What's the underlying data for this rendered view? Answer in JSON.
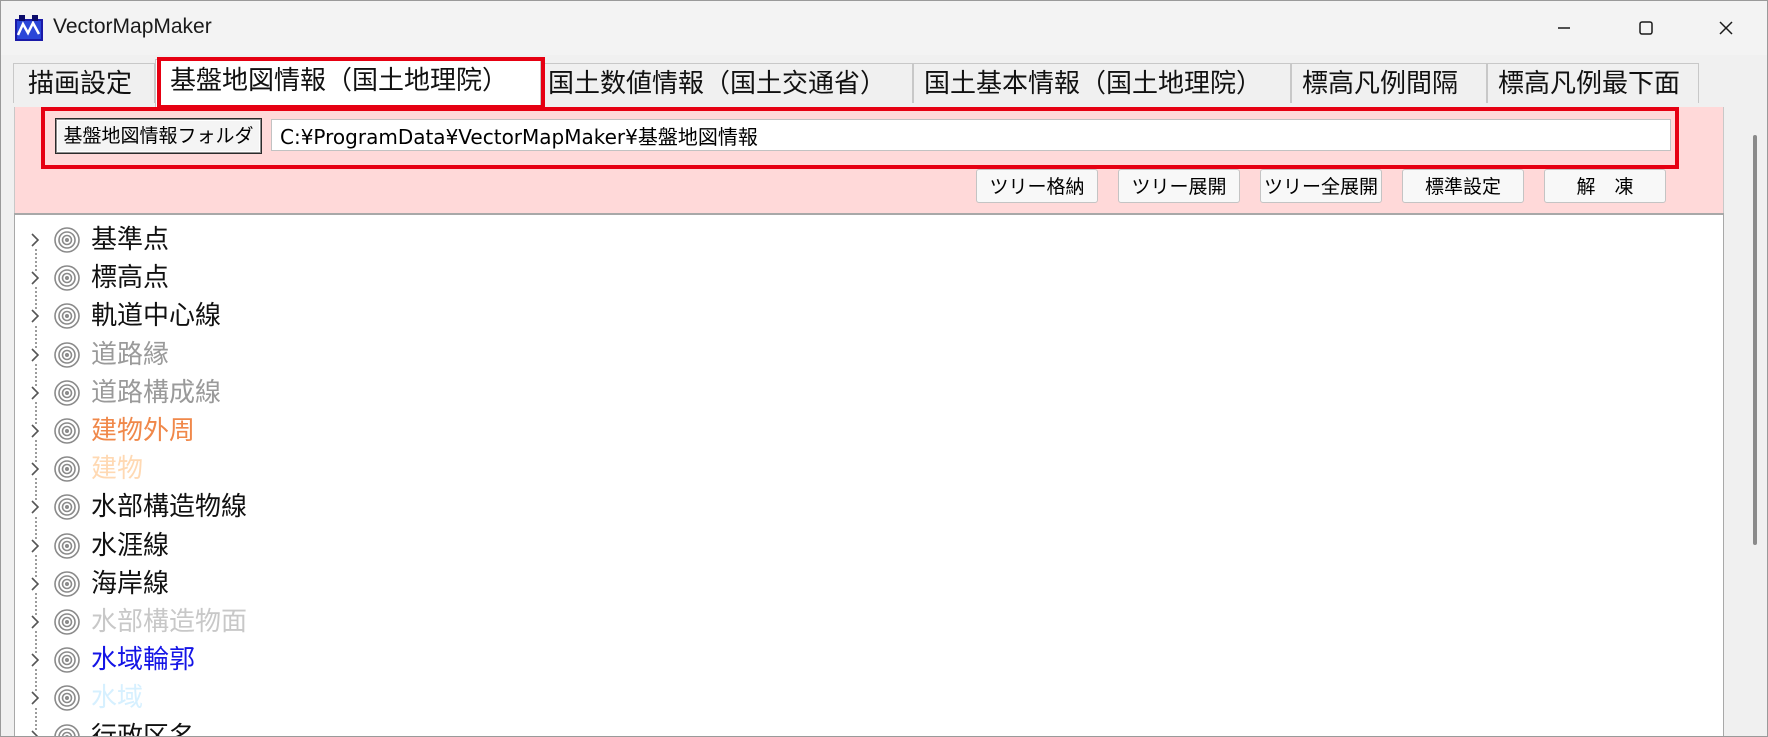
{
  "window": {
    "title": "VectorMapMaker"
  },
  "tabs": [
    {
      "label": "描画設定",
      "active": false
    },
    {
      "label": "基盤地図情報（国土地理院）",
      "active": true
    },
    {
      "label": "国土数値情報（国土交通省）",
      "active": false
    },
    {
      "label": "国土基本情報（国土地理院）",
      "active": false
    },
    {
      "label": "標高凡例間隔",
      "active": false
    },
    {
      "label": "標高凡例最下面",
      "active": false
    }
  ],
  "folder": {
    "button_label": "基盤地図情報フォルダ",
    "path_value": "C:¥ProgramData¥VectorMapMaker¥基盤地図情報"
  },
  "tree_buttons": [
    {
      "label": "ツリー格納"
    },
    {
      "label": "ツリー展開"
    },
    {
      "label": "ツリー全展開"
    },
    {
      "label": "標準設定"
    },
    {
      "label": "解　凍"
    }
  ],
  "tree_items": [
    {
      "label": "基準点",
      "color": "#111111"
    },
    {
      "label": "標高点",
      "color": "#111111"
    },
    {
      "label": "軌道中心線",
      "color": "#111111"
    },
    {
      "label": "道路縁",
      "color": "#9a9a9a"
    },
    {
      "label": "道路構成線",
      "color": "#9a9a9a"
    },
    {
      "label": "建物外周",
      "color": "#f0884a"
    },
    {
      "label": "建物",
      "color": "#ffd9b3"
    },
    {
      "label": "水部構造物線",
      "color": "#111111"
    },
    {
      "label": "水涯線",
      "color": "#111111"
    },
    {
      "label": "海岸線",
      "color": "#111111"
    },
    {
      "label": "水部構造物面",
      "color": "#c8c8c8"
    },
    {
      "label": "水域輪郭",
      "color": "#1414e6"
    },
    {
      "label": "水域",
      "color": "#d6f0ff"
    },
    {
      "label": "行政区名",
      "color": "#111111"
    }
  ],
  "colors": {
    "panel_background": "#ffd9d9",
    "highlight": "#e60012"
  },
  "icons": {
    "app": "vectormapmaker-app-icon",
    "tree_node": "target-icon",
    "expand": "chevron-right-icon"
  }
}
